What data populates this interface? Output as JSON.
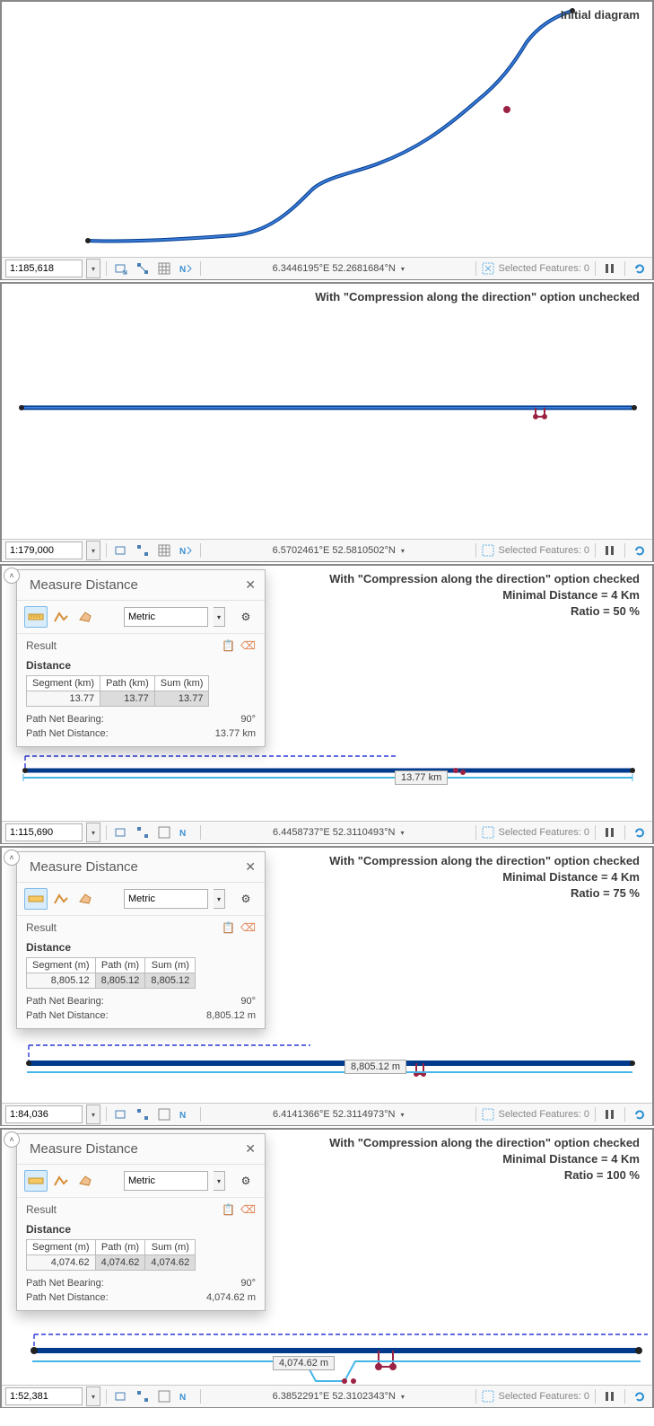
{
  "panels": [
    {
      "title": "Initial diagram",
      "scale": "1:185,618",
      "coords": "6.3446195°E 52.2681684°N",
      "selected_features": "Selected Features: 0"
    },
    {
      "title": "With \"Compression along the direction\" option unchecked",
      "scale": "1:179,000",
      "coords": "6.5702461°E 52.5810502°N",
      "selected_features": "Selected Features: 0"
    },
    {
      "title_line1": "With \"Compression along the direction\" option checked",
      "title_line2": "Minimal Distance = 4 Km",
      "title_line3": "Ratio = 50 %",
      "scale": "1:115,690",
      "coords": "6.4458737°E 52.3110493°N",
      "selected_features": "Selected Features: 0",
      "measure": {
        "title": "Measure Distance",
        "unit": "Metric",
        "result_label": "Result",
        "distance_label": "Distance",
        "headers": [
          "Segment (km)",
          "Path (km)",
          "Sum (km)"
        ],
        "values": [
          "13.77",
          "13.77",
          "13.77"
        ],
        "bearing_label": "Path Net Bearing:",
        "bearing": "90°",
        "dist_label": "Path Net Distance:",
        "dist": "13.77 km"
      },
      "annotation": "13.77 km"
    },
    {
      "title_line1": "With \"Compression along the direction\" option checked",
      "title_line2": "Minimal Distance = 4 Km",
      "title_line3": "Ratio = 75 %",
      "scale": "1:84,036",
      "coords": "6.4141366°E 52.3114973°N",
      "selected_features": "Selected Features: 0",
      "measure": {
        "title": "Measure Distance",
        "unit": "Metric",
        "result_label": "Result",
        "distance_label": "Distance",
        "headers": [
          "Segment (m)",
          "Path (m)",
          "Sum (m)"
        ],
        "values": [
          "8,805.12",
          "8,805.12",
          "8,805.12"
        ],
        "bearing_label": "Path Net Bearing:",
        "bearing": "90°",
        "dist_label": "Path Net Distance:",
        "dist": "8,805.12 m"
      },
      "annotation": "8,805.12 m"
    },
    {
      "title_line1": "With \"Compression along the direction\" option checked",
      "title_line2": "Minimal Distance = 4 Km",
      "title_line3": "Ratio = 100 %",
      "scale": "1:52,381",
      "coords": "6.3852291°E 52.3102343°N",
      "selected_features": "Selected Features: 0",
      "measure": {
        "title": "Measure Distance",
        "unit": "Metric",
        "result_label": "Result",
        "distance_label": "Distance",
        "headers": [
          "Segment (m)",
          "Path (m)",
          "Sum (m)"
        ],
        "values": [
          "4,074.62",
          "4,074.62",
          "4,074.62"
        ],
        "bearing_label": "Path Net Bearing:",
        "bearing": "90°",
        "dist_label": "Path Net Distance:",
        "dist": "4,074.62 m"
      },
      "annotation": "4,074.62 m"
    }
  ]
}
